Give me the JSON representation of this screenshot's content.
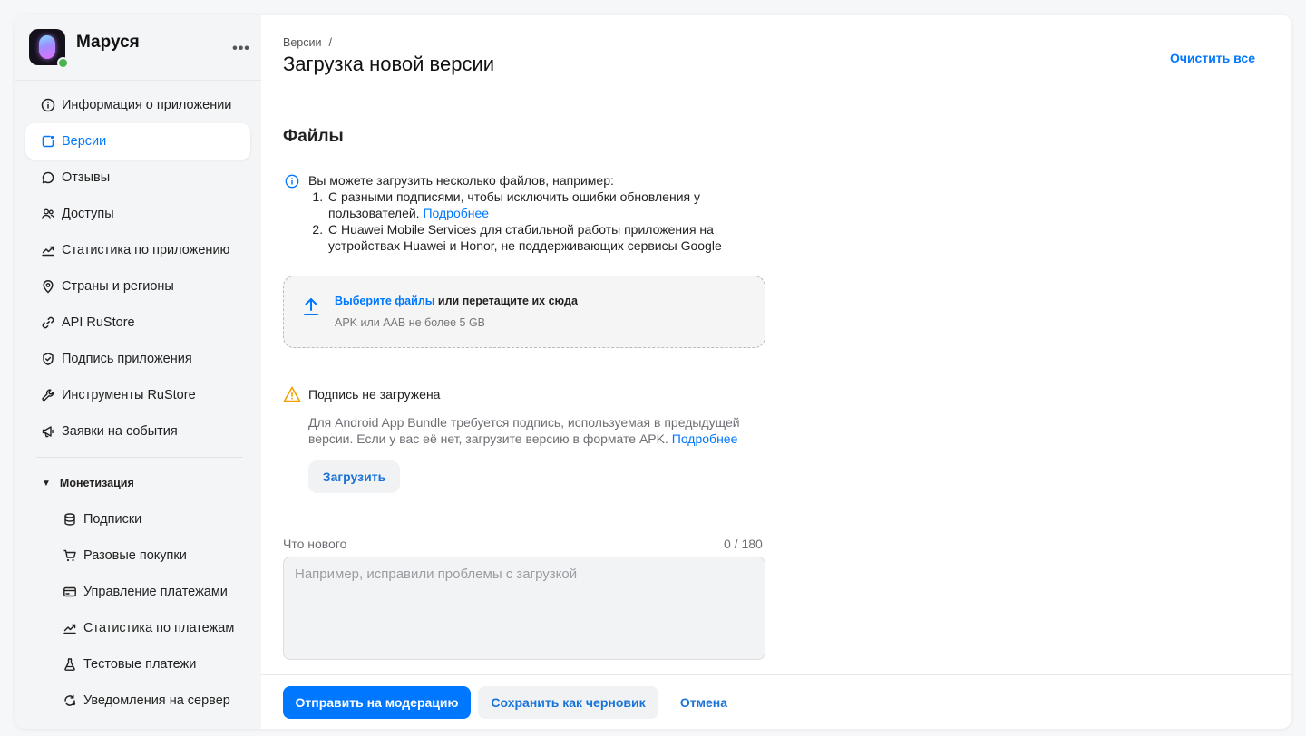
{
  "app": {
    "name": "Маруся",
    "status_color": "#4bb34b"
  },
  "sidebar": {
    "items": [
      {
        "label": "Информация о приложении",
        "icon": "info-icon",
        "active": false
      },
      {
        "label": "Версии",
        "icon": "versions-icon",
        "active": true
      },
      {
        "label": "Отзывы",
        "icon": "chat-icon",
        "active": false
      },
      {
        "label": "Доступы",
        "icon": "users-icon",
        "active": false
      },
      {
        "label": "Статистика по приложению",
        "icon": "trend-icon",
        "active": false
      },
      {
        "label": "Страны и регионы",
        "icon": "location-icon",
        "active": false
      },
      {
        "label": "API RuStore",
        "icon": "link-icon",
        "active": false
      },
      {
        "label": "Подпись приложения",
        "icon": "shield-icon",
        "active": false
      },
      {
        "label": "Инструменты RuStore",
        "icon": "wrench-icon",
        "active": false
      },
      {
        "label": "Заявки на события",
        "icon": "megaphone-icon",
        "active": false
      }
    ],
    "monetization": {
      "title": "Монетизация",
      "items": [
        {
          "label": "Подписки",
          "icon": "database-icon"
        },
        {
          "label": "Разовые покупки",
          "icon": "cart-icon"
        },
        {
          "label": "Управление платежами",
          "icon": "card-icon"
        },
        {
          "label": "Статистика по платежам",
          "icon": "trend-icon"
        },
        {
          "label": "Тестовые платежи",
          "icon": "flask-icon"
        },
        {
          "label": "Уведомления на сервер",
          "icon": "sync-icon"
        }
      ]
    }
  },
  "header": {
    "breadcrumb": "Версии",
    "breadcrumb_sep": "/",
    "title": "Загрузка новой версии",
    "clear_all": "Очистить все"
  },
  "files": {
    "title": "Файлы",
    "info_intro": "Вы можете загрузить несколько файлов, например:",
    "info_item1": "С разными подписями, чтобы исключить ошибки обновления у пользователей.",
    "info_item1_link": "Подробнее",
    "info_item2": "С Huawei Mobile Services для стабильной работы приложения на устройствах Huawei и Honor, не поддерживающих сервисы Google",
    "dropzone_link": "Выберите файлы",
    "dropzone_text": " или перетащите их сюда",
    "dropzone_hint": "APK или AAB не более 5 GB"
  },
  "signature": {
    "title": "Подпись не загружена",
    "desc": "Для Android App Bundle требуется подпись, используемая в предыдущей версии. Если у вас её нет, загрузите версию в формате APK.",
    "desc_link": "Подробнее",
    "upload_label": "Загрузить"
  },
  "whatsnew": {
    "label": "Что нового",
    "counter": "0 / 180",
    "value": "",
    "placeholder": "Например, исправили проблемы с загрузкой"
  },
  "footer": {
    "submit_label": "Отправить на модерацию",
    "draft_label": "Сохранить как черновик",
    "cancel_label": "Отмена"
  },
  "colors": {
    "accent": "#0077ff",
    "warning": "#f2a100"
  }
}
